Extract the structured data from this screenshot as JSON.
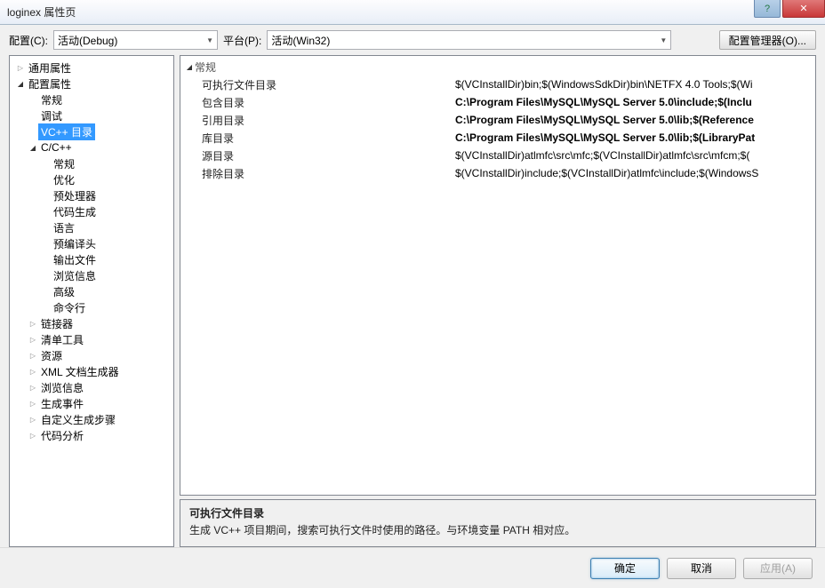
{
  "window": {
    "title": "loginex 属性页"
  },
  "toolbar": {
    "config_label": "配置(C):",
    "config_value": "活动(Debug)",
    "platform_label": "平台(P):",
    "platform_value": "活动(Win32)",
    "manager_btn": "配置管理器(O)..."
  },
  "tree": [
    {
      "indent": 1,
      "arrow": "▷",
      "label": "通用属性"
    },
    {
      "indent": 1,
      "arrow": "▲",
      "label": "配置属性"
    },
    {
      "indent": 2,
      "arrow": "",
      "label": "常规"
    },
    {
      "indent": 2,
      "arrow": "",
      "label": "调试"
    },
    {
      "indent": 2,
      "arrow": "",
      "label": "VC++ 目录",
      "selected": true
    },
    {
      "indent": 2,
      "arrow": "▲",
      "label": "C/C++"
    },
    {
      "indent": 3,
      "arrow": "",
      "label": "常规"
    },
    {
      "indent": 3,
      "arrow": "",
      "label": "优化"
    },
    {
      "indent": 3,
      "arrow": "",
      "label": "预处理器"
    },
    {
      "indent": 3,
      "arrow": "",
      "label": "代码生成"
    },
    {
      "indent": 3,
      "arrow": "",
      "label": "语言"
    },
    {
      "indent": 3,
      "arrow": "",
      "label": "预编译头"
    },
    {
      "indent": 3,
      "arrow": "",
      "label": "输出文件"
    },
    {
      "indent": 3,
      "arrow": "",
      "label": "浏览信息"
    },
    {
      "indent": 3,
      "arrow": "",
      "label": "高级"
    },
    {
      "indent": 3,
      "arrow": "",
      "label": "命令行"
    },
    {
      "indent": 2,
      "arrow": "▷",
      "label": "链接器"
    },
    {
      "indent": 2,
      "arrow": "▷",
      "label": "清单工具"
    },
    {
      "indent": 2,
      "arrow": "▷",
      "label": "资源"
    },
    {
      "indent": 2,
      "arrow": "▷",
      "label": "XML 文档生成器"
    },
    {
      "indent": 2,
      "arrow": "▷",
      "label": "浏览信息"
    },
    {
      "indent": 2,
      "arrow": "▷",
      "label": "生成事件"
    },
    {
      "indent": 2,
      "arrow": "▷",
      "label": "自定义生成步骤"
    },
    {
      "indent": 2,
      "arrow": "▷",
      "label": "代码分析"
    }
  ],
  "props": {
    "group_title": "常规",
    "rows": [
      {
        "key": "可执行文件目录",
        "val": "$(VCInstallDir)bin;$(WindowsSdkDir)bin\\NETFX 4.0 Tools;$(Wi",
        "bold": false
      },
      {
        "key": "包含目录",
        "val": "C:\\Program Files\\MySQL\\MySQL Server 5.0\\include;$(Inclu",
        "bold": true
      },
      {
        "key": "引用目录",
        "val": "C:\\Program Files\\MySQL\\MySQL Server 5.0\\lib;$(Reference",
        "bold": true
      },
      {
        "key": "库目录",
        "val": "C:\\Program Files\\MySQL\\MySQL Server 5.0\\lib;$(LibraryPat",
        "bold": true
      },
      {
        "key": "源目录",
        "val": "$(VCInstallDir)atlmfc\\src\\mfc;$(VCInstallDir)atlmfc\\src\\mfcm;$(",
        "bold": false
      },
      {
        "key": "排除目录",
        "val": "$(VCInstallDir)include;$(VCInstallDir)atlmfc\\include;$(WindowsS",
        "bold": false
      }
    ]
  },
  "description": {
    "title": "可执行文件目录",
    "text": "生成 VC++ 项目期间，搜索可执行文件时使用的路径。与环境变量 PATH 相对应。"
  },
  "footer": {
    "ok": "确定",
    "cancel": "取消",
    "apply": "应用(A)"
  }
}
